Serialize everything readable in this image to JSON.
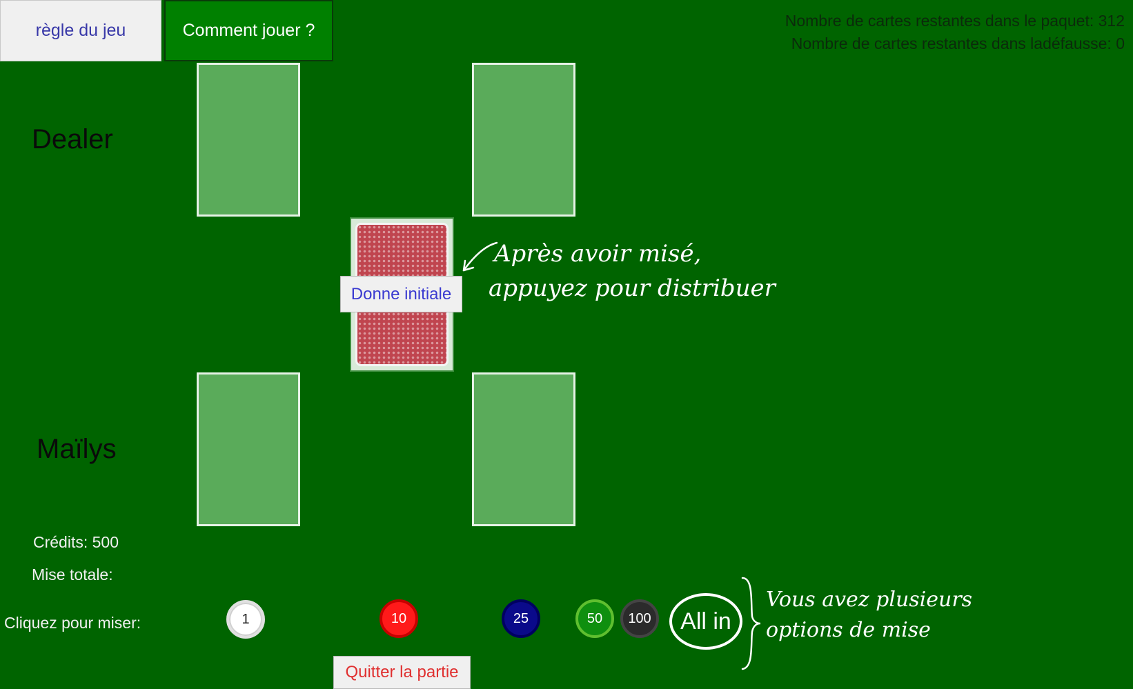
{
  "toolbar": {
    "rules_label": "règle du jeu",
    "how_to_play_label": "Comment jouer ?"
  },
  "counters": {
    "deck_remaining": "Nombre de cartes restantes dans le paquet: 312",
    "discard_remaining": "Nombre de cartes restantes dans ladéfausse: 0"
  },
  "players": {
    "dealer_name": "Dealer",
    "player_name": "Maïlys"
  },
  "deal": {
    "button_label": "Donne initiale"
  },
  "annotations": {
    "deal_line1": "Après avoir misé,",
    "deal_line2": "appuyez pour distribuer",
    "bet_line1": "Vous avez plusieurs",
    "bet_line2": "options de mise"
  },
  "info": {
    "credits": "Crédits: 500",
    "total_bet": "Mise totale:",
    "click_to_bet": "Cliquez pour miser:"
  },
  "chips": {
    "c1": "1",
    "c10": "10",
    "c25": "25",
    "c50": "50",
    "c100": "100",
    "allin": "All in"
  },
  "quit": {
    "label": "Quitter la partie"
  },
  "colors": {
    "table": "#006400",
    "card_slot": "#5aab5a",
    "chip_10": "#ff1a1a",
    "chip_25": "#0a0a8a",
    "chip_50": "#0f8f0f",
    "chip_100": "#2b2b2b"
  }
}
